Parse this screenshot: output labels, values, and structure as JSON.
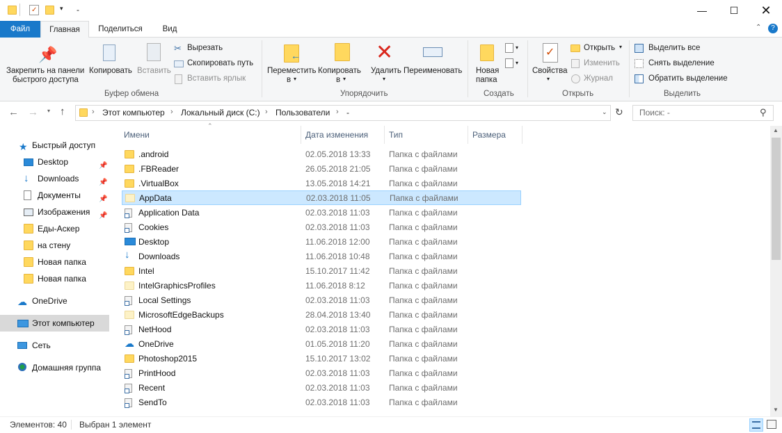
{
  "title": "-",
  "tabs": {
    "file": "Файл",
    "home": "Главная",
    "share": "Поделиться",
    "view": "Вид"
  },
  "ribbon": {
    "pin": "Закрепить на панели быстрого доступа",
    "pin_l1": "Закрепить на панели",
    "pin_l2": "быстрого доступа",
    "copy": "Копировать",
    "paste": "Вставить",
    "cut": "Вырезать",
    "copy_path": "Скопировать путь",
    "paste_shortcut": "Вставить ярлык",
    "group_clipboard": "Буфер обмена",
    "move_l1": "Переместить",
    "move_l2": "в",
    "copyto_l1": "Копировать",
    "copyto_l2": "в",
    "delete": "Удалить",
    "rename": "Переименовать",
    "group_organize": "Упорядочить",
    "newfolder_l1": "Новая",
    "newfolder_l2": "папка",
    "group_create": "Создать",
    "properties": "Свойства",
    "open": "Открыть",
    "edit": "Изменить",
    "history": "Журнал",
    "group_open": "Открыть",
    "select_all": "Выделить все",
    "select_none": "Снять выделение",
    "invert": "Обратить выделение",
    "group_select": "Выделить"
  },
  "address": {
    "crumbs": [
      "Этот компьютер",
      "Локальный диск (C:)",
      "Пользователи",
      "-"
    ]
  },
  "search": {
    "placeholder": "Поиск: -"
  },
  "nav": {
    "quick": "Быстрый доступ",
    "items": [
      "Desktop",
      "Downloads",
      "Документы",
      "Изображения",
      "Еды-Аскер",
      "на стену",
      "Новая папка",
      "Новая папка"
    ],
    "onedrive": "OneDrive",
    "thispc": "Этот компьютер",
    "network": "Сеть",
    "homegroup": "Домашняя группа"
  },
  "columns": {
    "name": "Имени",
    "date": "Дата изменения",
    "type": "Тип",
    "size": "Размера"
  },
  "files": [
    {
      "name": ".android",
      "date": "02.05.2018 13:33",
      "type": "Папка с файлами",
      "icon": "folder"
    },
    {
      "name": ".FBReader",
      "date": "26.05.2018 21:05",
      "type": "Папка с файлами",
      "icon": "folder"
    },
    {
      "name": ".VirtualBox",
      "date": "13.05.2018 14:21",
      "type": "Папка с файлами",
      "icon": "folder"
    },
    {
      "name": "AppData",
      "date": "02.03.2018 11:05",
      "type": "Папка с файлами",
      "icon": "folder-pale"
    },
    {
      "name": "Application Data",
      "date": "02.03.2018 11:03",
      "type": "Папка с файлами",
      "icon": "shortcut"
    },
    {
      "name": "Cookies",
      "date": "02.03.2018 11:03",
      "type": "Папка с файлами",
      "icon": "shortcut"
    },
    {
      "name": "Desktop",
      "date": "11.06.2018 12:00",
      "type": "Папка с файлами",
      "icon": "desktop"
    },
    {
      "name": "Downloads",
      "date": "11.06.2018 10:48",
      "type": "Папка с файлами",
      "icon": "download"
    },
    {
      "name": "Intel",
      "date": "15.10.2017 11:42",
      "type": "Папка с файлами",
      "icon": "folder"
    },
    {
      "name": "IntelGraphicsProfiles",
      "date": "11.06.2018 8:12",
      "type": "Папка с файлами",
      "icon": "folder-pale"
    },
    {
      "name": "Local Settings",
      "date": "02.03.2018 11:03",
      "type": "Папка с файлами",
      "icon": "shortcut"
    },
    {
      "name": "MicrosoftEdgeBackups",
      "date": "28.04.2018 13:40",
      "type": "Папка с файлами",
      "icon": "folder-pale"
    },
    {
      "name": "NetHood",
      "date": "02.03.2018 11:03",
      "type": "Папка с файлами",
      "icon": "shortcut"
    },
    {
      "name": "OneDrive",
      "date": "01.05.2018 11:20",
      "type": "Папка с файлами",
      "icon": "cloud"
    },
    {
      "name": "Photoshop2015",
      "date": "15.10.2017 13:02",
      "type": "Папка с файлами",
      "icon": "folder"
    },
    {
      "name": "PrintHood",
      "date": "02.03.2018 11:03",
      "type": "Папка с файлами",
      "icon": "shortcut"
    },
    {
      "name": "Recent",
      "date": "02.03.2018 11:03",
      "type": "Папка с файлами",
      "icon": "shortcut"
    },
    {
      "name": "SendTo",
      "date": "02.03.2018 11:03",
      "type": "Папка с файлами",
      "icon": "shortcut"
    }
  ],
  "selected_index": 3,
  "status": {
    "count": "Элементов: 40",
    "selected": "Выбран 1 элемент"
  },
  "colors": {
    "accent": "#1979ca",
    "selection": "#cce8ff",
    "folder": "#ffd85e"
  }
}
